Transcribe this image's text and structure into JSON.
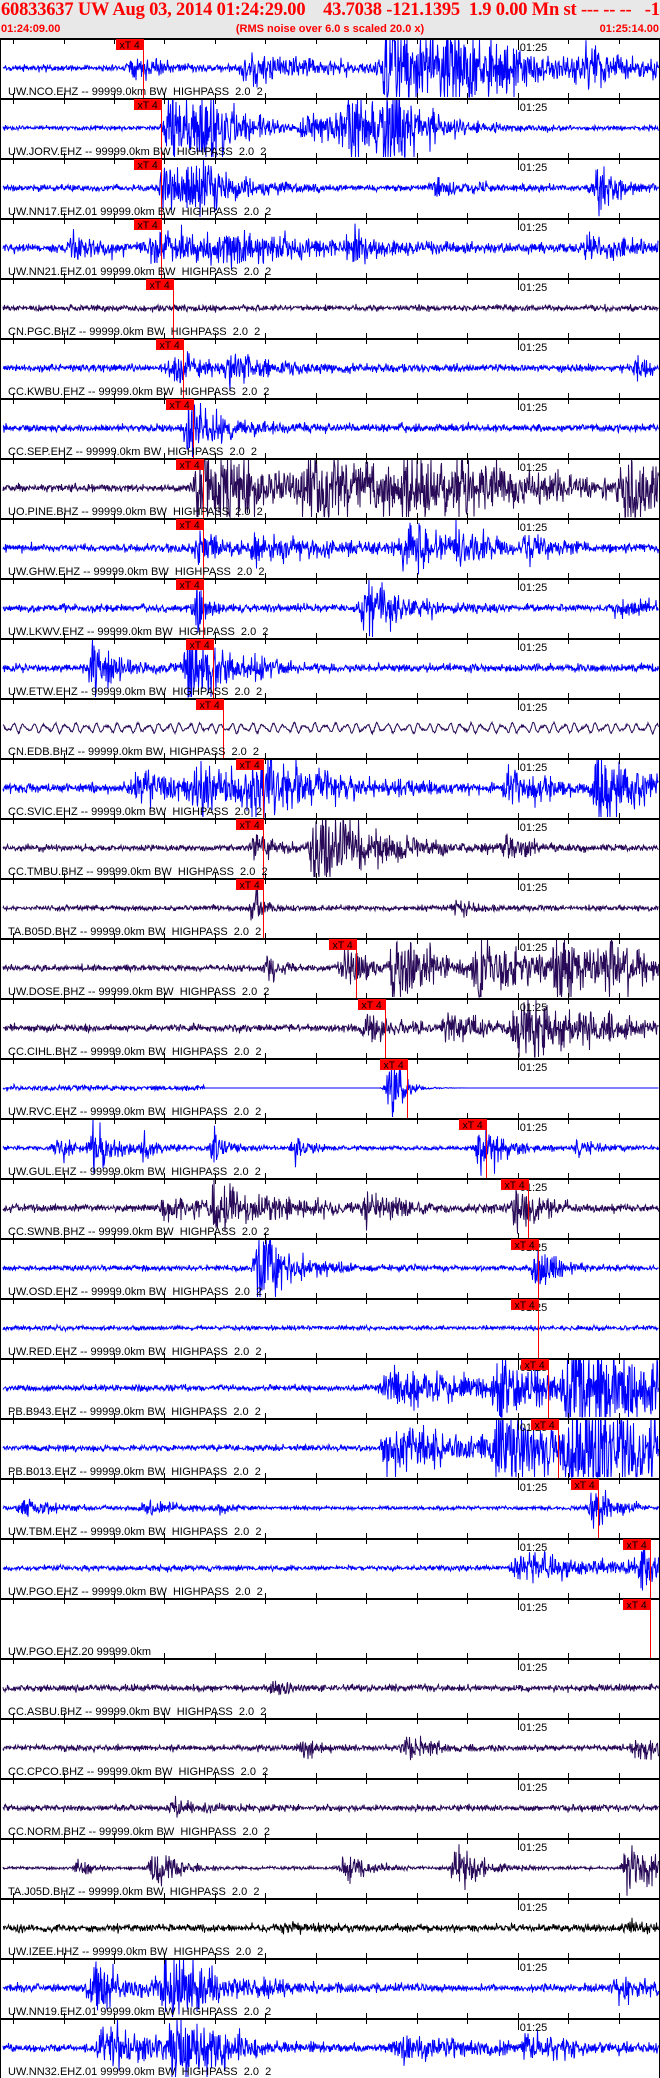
{
  "header": {
    "title": "60833637 UW Aug 03, 2014 01:24:29.00    43.7038 -121.1395  1.9 0.00 Mn st --- -- --   -1",
    "start_time": "01:24:09.00",
    "scaling_note": "(RMS noise over 6.0 s scaled 20.0 x)",
    "end_time": "01:25:14.00"
  },
  "colors": {
    "blue": "#0000ff",
    "purple": "#280a58",
    "black": "#000000",
    "pick": "#ff0000",
    "axis": "#000000"
  },
  "chart_data": {
    "type": "line",
    "title": "60833637 UW Aug 03, 2014 01:24:29.00",
    "x_unit": "seconds after 01:24:09.00",
    "xlim": [
      0,
      65
    ],
    "minute_tick_label": "01:25",
    "minute_tick_time": 51,
    "pick_label": "xT 4",
    "traces": [
      {
        "label": "UW.NCO.EHZ -- 99999.0km BW  HIGHPASS  2.0  2",
        "color": "blue",
        "pick": 13.9,
        "base": 0.08,
        "bursts": [
          [
            13,
            0.3,
            3
          ],
          [
            24,
            0.4,
            8
          ],
          [
            38,
            1.3,
            7
          ],
          [
            44,
            0.6,
            10
          ],
          [
            58,
            0.3,
            4
          ]
        ]
      },
      {
        "label": "UW.JORV.EHZ -- 99999.0km BW  HIGHPASS  2.0  2",
        "color": "blue",
        "pick": 15.7,
        "base": 0.06,
        "bursts": [
          [
            16.5,
            1.1,
            3
          ],
          [
            20,
            0.9,
            3
          ],
          [
            30,
            0.4,
            8
          ],
          [
            34,
            1.0,
            3
          ],
          [
            38,
            1.0,
            3
          ]
        ]
      },
      {
        "label": "UW.NN17.EHZ.01 99999.0km BW  HIGHPASS  2.0  2",
        "color": "blue",
        "pick": 15.7,
        "base": 0.08,
        "bursts": [
          [
            16,
            0.7,
            3
          ],
          [
            18.5,
            0.6,
            4
          ],
          [
            43,
            0.2,
            3
          ],
          [
            59,
            0.6,
            2
          ]
        ]
      },
      {
        "label": "UW.NN21.EHZ.01 99999.0km BW  HIGHPASS  2.0  2",
        "color": "blue",
        "pick": 15.7,
        "base": 0.12,
        "bursts": [
          [
            7,
            0.3,
            3
          ],
          [
            15,
            0.5,
            6
          ],
          [
            22,
            0.3,
            10
          ],
          [
            35,
            0.4,
            1
          ],
          [
            58,
            0.3,
            4
          ]
        ]
      },
      {
        "label": "CN.PGC.BHZ -- 99999.0km BW  HIGHPASS  2.0  2",
        "color": "purple",
        "pick": 16.8,
        "base": 0.08,
        "bursts": []
      },
      {
        "label": "CC.KWBU.EHZ -- 99999.0km BW  HIGHPASS  2.0  2",
        "color": "blue",
        "pick": 17.8,
        "base": 0.1,
        "bursts": [
          [
            17,
            0.5,
            2
          ],
          [
            22.5,
            0.4,
            4
          ],
          [
            63,
            0.3,
            1
          ]
        ]
      },
      {
        "label": "CC.SEP.EHZ -- 99999.0km BW  HIGHPASS  2.0  2",
        "color": "blue",
        "pick": 18.8,
        "base": 0.1,
        "bursts": [
          [
            18.5,
            0.9,
            3
          ]
        ]
      },
      {
        "label": "UO.PINE.BHZ -- 99999.0km BW  HIGHPASS  2.0  2",
        "color": "purple",
        "pick": 19.8,
        "base": 0.1,
        "bursts": [
          [
            19.5,
            1.4,
            7
          ],
          [
            30,
            1.0,
            10
          ],
          [
            40,
            0.8,
            3
          ],
          [
            45,
            0.5,
            10
          ],
          [
            61.5,
            1.4,
            3
          ]
        ]
      },
      {
        "label": "UW.GHW.EHZ -- 99999.0km BW  HIGHPASS  2.0  2",
        "color": "blue",
        "pick": 19.8,
        "base": 0.1,
        "bursts": [
          [
            19.5,
            0.5,
            2
          ],
          [
            25,
            0.3,
            10
          ],
          [
            40,
            0.7,
            3
          ],
          [
            45,
            0.5,
            3
          ],
          [
            52,
            0.4,
            2
          ]
        ]
      },
      {
        "label": "UW.LKWV.EHZ -- 99999.0km BW  HIGHPASS  2.0  2",
        "color": "blue",
        "pick": 19.8,
        "base": 0.1,
        "bursts": [
          [
            19.2,
            0.6,
            1
          ],
          [
            36,
            0.9,
            3
          ],
          [
            61,
            0.2,
            4
          ]
        ]
      },
      {
        "label": "UW.ETW.EHZ -- 99999.0km BW  HIGHPASS  2.0  2",
        "color": "blue",
        "pick": 20.8,
        "base": 0.1,
        "bursts": [
          [
            9,
            0.9,
            2
          ],
          [
            18.5,
            1.1,
            3
          ],
          [
            25,
            0.3,
            1
          ]
        ]
      },
      {
        "label": "CN.EDB.BHZ -- 99999.0km BW  HIGHPASS  2.0  2",
        "color": "purple",
        "pick": 21.8,
        "base": 0.2,
        "bursts": [],
        "mode": "lowfreq"
      },
      {
        "label": "CC.SVIC.EHZ -- 99999.0km BW  HIGHPASS  2.0  2",
        "color": "blue",
        "pick": 25.8,
        "base": 0.12,
        "bursts": [
          [
            13,
            0.4,
            6
          ],
          [
            19,
            0.7,
            4
          ],
          [
            25,
            0.9,
            6
          ],
          [
            50,
            0.5,
            4
          ],
          [
            59,
            1.1,
            4
          ]
        ]
      },
      {
        "label": "CC.TMBU.BHZ -- 99999.0km BW  HIGHPASS  2.0  2",
        "color": "purple",
        "pick": 25.8,
        "base": 0.08,
        "bursts": [
          [
            25,
            0.4,
            2
          ],
          [
            31,
            1.5,
            5
          ],
          [
            50,
            0.3,
            2
          ]
        ]
      },
      {
        "label": "TA.B05D.BHZ -- 99999.0km BW  HIGHPASS  2.0  2",
        "color": "purple",
        "pick": 25.8,
        "base": 0.07,
        "bursts": [
          [
            25,
            0.5,
            1
          ],
          [
            45,
            0.2,
            2
          ]
        ]
      },
      {
        "label": "UW.DOSE.BHZ -- 99999.0km BW  HIGHPASS  2.0  2",
        "color": "purple",
        "pick": 35.0,
        "base": 0.08,
        "bursts": [
          [
            26.5,
            0.4,
            1
          ],
          [
            34,
            0.7,
            2
          ],
          [
            39,
            1.3,
            3
          ],
          [
            47,
            0.9,
            5
          ],
          [
            55,
            0.9,
            4
          ],
          [
            60,
            0.5,
            4
          ]
        ]
      },
      {
        "label": "CC.CIHL.BHZ -- 99999.0km BW  HIGHPASS  2.0  2",
        "color": "purple",
        "pick": 37.9,
        "base": 0.1,
        "bursts": [
          [
            36,
            0.4,
            3
          ],
          [
            44,
            0.4,
            3
          ],
          [
            51,
            0.9,
            8
          ]
        ]
      },
      {
        "label": "UW.RVC.EHZ -- 99999.0km BW  HIGHPASS  2.0  2",
        "color": "blue",
        "pick": 40.0,
        "base": 0.07,
        "bursts": [
          [
            38.5,
            1.0,
            1.2
          ]
        ],
        "mode": "gap"
      },
      {
        "label": "UW.GUL.EHZ -- 99999.0km BW  HIGHPASS  2.0  2",
        "color": "blue",
        "pick": 47.9,
        "base": 0.06,
        "bursts": [
          [
            5.5,
            0.4,
            1
          ],
          [
            9,
            0.7,
            2
          ],
          [
            14,
            0.4,
            1
          ],
          [
            21,
            0.5,
            1
          ],
          [
            29,
            0.4,
            1
          ],
          [
            47.5,
            0.8,
            2
          ],
          [
            57,
            0.2,
            2
          ]
        ]
      },
      {
        "label": "CC.SWNB.BHZ -- 99999.0km BW  HIGHPASS  2.0  2",
        "color": "purple",
        "pick": 52.0,
        "base": 0.1,
        "bursts": [
          [
            16,
            0.3,
            6
          ],
          [
            21,
            0.5,
            6
          ],
          [
            36,
            0.4,
            3
          ],
          [
            51,
            0.6,
            2
          ]
        ]
      },
      {
        "label": "UW.OSD.EHZ -- 99999.0km BW  HIGHPASS  2.0  2",
        "color": "blue",
        "pick": 53.0,
        "base": 0.07,
        "bursts": [
          [
            25.5,
            1.2,
            3
          ],
          [
            53,
            0.7,
            1.5
          ]
        ]
      },
      {
        "label": "UW.RED.EHZ -- 99999.0km BW  HIGHPASS  2.0  2",
        "color": "blue",
        "pick": 53.0,
        "base": 0.06,
        "bursts": []
      },
      {
        "label": "PB.B943.EHZ -- 99999.0km BW  HIGHPASS  2.0  2",
        "color": "blue",
        "pick": 54.0,
        "base": 0.08,
        "bursts": [
          [
            38,
            0.5,
            12
          ],
          [
            49,
            0.6,
            6
          ],
          [
            56,
            1.6,
            9
          ]
        ]
      },
      {
        "label": "PB.B013.EHZ -- 99999.0km BW  HIGHPASS  2.0  2",
        "color": "blue",
        "pick": 55.0,
        "base": 0.08,
        "bursts": [
          [
            38,
            0.6,
            12
          ],
          [
            49,
            0.9,
            6
          ],
          [
            56,
            1.6,
            9
          ]
        ]
      },
      {
        "label": "UW.TBM.EHZ -- 99999.0km BW  HIGHPASS  2.0  2",
        "color": "blue",
        "pick": 59.0,
        "base": 0.05,
        "bursts": [
          [
            2,
            0.2,
            3
          ],
          [
            14,
            0.2,
            3
          ],
          [
            21.5,
            0.2,
            1
          ],
          [
            58.5,
            0.6,
            2
          ]
        ]
      },
      {
        "label": "UW.PGO.EHZ -- 99999.0km BW  HIGHPASS  2.0  2",
        "color": "blue",
        "pick": 64.1,
        "base": 0.07,
        "bursts": [
          [
            51,
            0.4,
            8
          ],
          [
            63.5,
            0.7,
            1.5
          ]
        ]
      },
      {
        "label": "UW.PGO.EHZ.20 99999.0km",
        "color": "blue",
        "pick": 64.1,
        "base": 0,
        "bursts": [],
        "mode": "flat"
      },
      {
        "label": "CC.ASBU.BHZ -- 99999.0km BW  HIGHPASS  2.0  2",
        "color": "purple",
        "pick": null,
        "base": 0.09,
        "bursts": [
          [
            27,
            0.2,
            1
          ]
        ]
      },
      {
        "label": "CC.CPCO.BHZ -- 99999.0km BW  HIGHPASS  2.0  2",
        "color": "purple",
        "pick": null,
        "base": 0.08,
        "bursts": [
          [
            30,
            0.3,
            1
          ],
          [
            40,
            0.4,
            2
          ],
          [
            63,
            0.3,
            2
          ]
        ]
      },
      {
        "label": "CC.NORM.BHZ -- 99999.0km BW  HIGHPASS  2.0  2",
        "color": "purple",
        "pick": null,
        "base": 0.08,
        "bursts": [
          [
            17,
            0.2,
            2
          ]
        ]
      },
      {
        "label": "TA.J05D.BHZ -- 99999.0km BW  HIGHPASS  2.0  2",
        "color": "purple",
        "pick": null,
        "base": 0.04,
        "bursts": [
          [
            7.5,
            0.3,
            1
          ],
          [
            15,
            0.6,
            2
          ],
          [
            34,
            0.5,
            2
          ],
          [
            45,
            0.7,
            2
          ],
          [
            62,
            0.7,
            3
          ]
        ]
      },
      {
        "label": "UW.IZEE.HHZ -- 99999.0km BW  HIGHPASS  2.0  2",
        "color": "black",
        "pick": null,
        "base": 0.1,
        "bursts": [
          [
            28,
            0.1,
            2
          ],
          [
            62,
            0.15,
            2
          ]
        ]
      },
      {
        "label": "UW.NN19.EHZ.01 99999.0km BW  HIGHPASS  2.0  2",
        "color": "blue",
        "pick": null,
        "base": 0.1,
        "bursts": [
          [
            9,
            0.7,
            4
          ],
          [
            16,
            0.8,
            6
          ],
          [
            61,
            0.3,
            3
          ]
        ]
      },
      {
        "label": "UW.NN32.EHZ.01 99999.0km BW  HIGHPASS  2.0  2",
        "color": "blue",
        "pick": null,
        "base": 0.1,
        "bursts": [
          [
            10,
            0.6,
            5
          ],
          [
            17,
            1.1,
            4
          ],
          [
            39,
            0.3,
            8
          ],
          [
            52,
            0.3,
            5
          ]
        ]
      }
    ]
  }
}
